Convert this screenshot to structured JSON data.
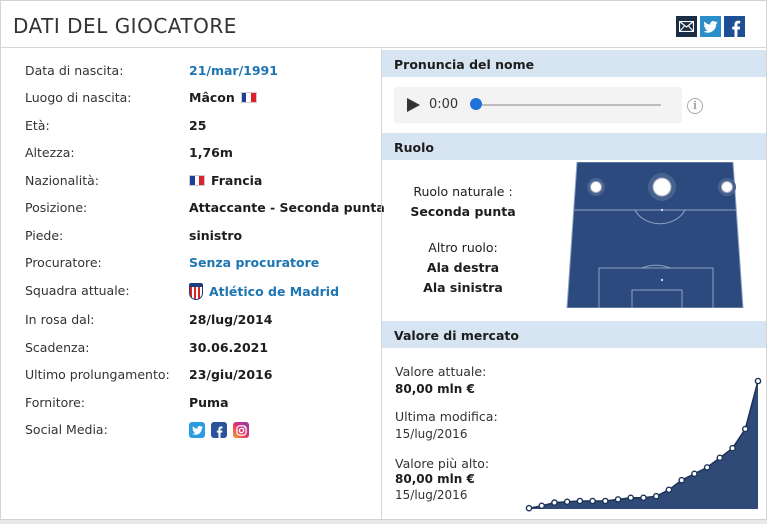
{
  "header": {
    "title": "DATI DEL GIOCATORE"
  },
  "share": {
    "mail_icon": "mail-icon",
    "twitter_icon": "twitter-icon",
    "facebook_icon": "facebook-icon"
  },
  "profile": [
    {
      "label": "Data di nascita:",
      "value": "21/mar/1991",
      "link": true
    },
    {
      "label": "Luogo di nascita:",
      "value": "Mâcon",
      "flag": "france"
    },
    {
      "label": "Età:",
      "value": "25"
    },
    {
      "label": "Altezza:",
      "value": "1,76m"
    },
    {
      "label": "Nazionalità:",
      "value": "Francia",
      "flag_before": "france"
    },
    {
      "label": "Posizione:",
      "value": "Attaccante - Seconda punta"
    },
    {
      "label": "Piede:",
      "value": "sinistro"
    },
    {
      "label": "Procuratore:",
      "value": "Senza procuratore",
      "link": true
    },
    {
      "label": "Squadra attuale:",
      "value": "Atlético de Madrid",
      "link": true,
      "crest": true
    },
    {
      "label": "In rosa dal:",
      "value": "28/lug/2014"
    },
    {
      "label": "Scadenza:",
      "value": "30.06.2021"
    },
    {
      "label": "Ultimo prolungamento:",
      "value": "23/giu/2016"
    },
    {
      "label": "Fornitore:",
      "value": "Puma"
    },
    {
      "label": "Social Media:",
      "value": ""
    }
  ],
  "pronunciation": {
    "heading": "Pronuncia del nome",
    "time": "0:00",
    "progress": 0
  },
  "role": {
    "heading": "Ruolo",
    "natural_label": "Ruolo naturale :",
    "natural_value": "Seconda punta",
    "other_label": "Altro ruolo:",
    "other_values": [
      "Ala destra",
      "Ala sinistra"
    ]
  },
  "market": {
    "heading": "Valore di mercato",
    "current_label": "Valore attuale:",
    "current_value": "80,00 mln €",
    "last_change_label": "Ultima modifica:",
    "last_change_date": "15/lug/2016",
    "highest_label": "Valore più alto:",
    "highest_value": "80,00 mln €",
    "highest_date": "15/lug/2016",
    "colors": {
      "fill": "#2f4a77",
      "line": "#1c3358"
    }
  },
  "chart_data": {
    "type": "area",
    "x": [
      1,
      2,
      3,
      4,
      5,
      6,
      7,
      8,
      9,
      10,
      11,
      12,
      13,
      14,
      15,
      16,
      17,
      18,
      19
    ],
    "values": [
      0.5,
      2,
      4,
      4.5,
      5,
      5,
      5,
      6,
      7,
      7,
      8,
      12,
      18,
      22,
      26,
      32,
      38,
      50,
      80
    ],
    "title": "",
    "xlabel": "",
    "ylabel": ""
  }
}
